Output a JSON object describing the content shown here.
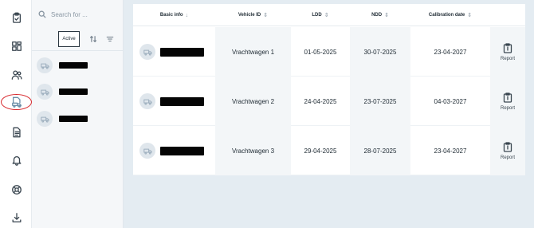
{
  "sidebar": {
    "items": [
      {
        "icon": "clipboard-icon"
      },
      {
        "icon": "dashboard-icon"
      },
      {
        "icon": "users-icon"
      },
      {
        "icon": "truck-document-icon",
        "active": true
      },
      {
        "icon": "document-icon"
      },
      {
        "icon": "bell-icon"
      },
      {
        "icon": "help-icon"
      },
      {
        "icon": "download-icon"
      }
    ]
  },
  "list_panel": {
    "search_placeholder": "Search for ...",
    "filter_active_label": "Active",
    "vehicles": [
      {
        "icon": "truck-icon"
      },
      {
        "icon": "truck-icon"
      },
      {
        "icon": "truck-icon"
      }
    ]
  },
  "table": {
    "columns": [
      {
        "label": "Basic info"
      },
      {
        "label": "Vehicle ID"
      },
      {
        "label": "LDD"
      },
      {
        "label": "NDD"
      },
      {
        "label": "Calibration date"
      }
    ],
    "rows": [
      {
        "vehicle_id": "Vrachtwagen 1",
        "ldd": "01-05-2025",
        "ndd": "30-07-2025",
        "calibration": "23-04-2027",
        "action": "Report"
      },
      {
        "vehicle_id": "Vrachtwagen 2",
        "ldd": "24-04-2025",
        "ndd": "23-07-2025",
        "calibration": "04-03-2027",
        "action": "Report"
      },
      {
        "vehicle_id": "Vrachtwagen 3",
        "ldd": "29-04-2025",
        "ndd": "28-07-2025",
        "calibration": "23-04-2027",
        "action": "Report"
      }
    ]
  },
  "colors": {
    "background": "#e4ecf2",
    "panel": "#f5f7f9",
    "shaded_column": "#f3f6f8",
    "highlight_ring": "#d7262b",
    "text": "#1e2a33"
  }
}
